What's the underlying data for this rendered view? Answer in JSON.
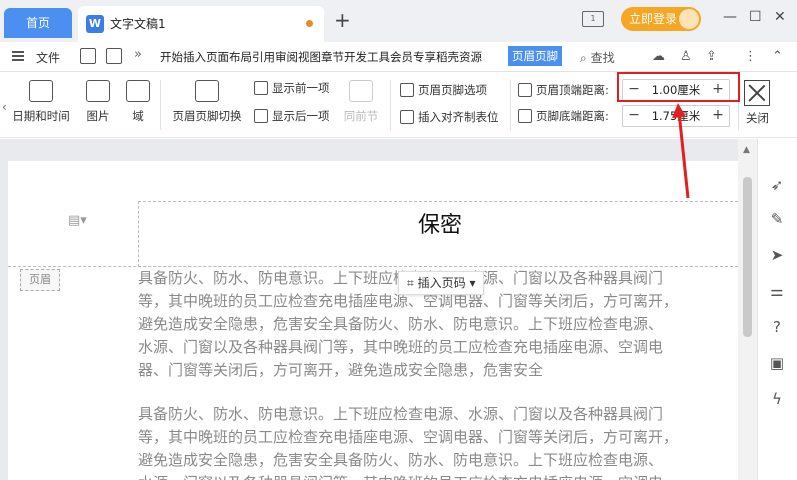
{
  "titlebar": {
    "home_tab": "首页",
    "doc_icon": "W",
    "doc_name": "文字文稿1",
    "new_tab": "+",
    "layout_icon": "1",
    "login_label": "立即登录",
    "minimize": "—",
    "maximize": "☐",
    "close": "✕"
  },
  "menubar": {
    "file_label": "文件",
    "more": "»",
    "tabs": [
      "开始",
      "插入",
      "页面布局",
      "引用",
      "审阅",
      "视图",
      "章节",
      "开发工具",
      "会员专享",
      "稻壳资源"
    ],
    "active_tab": "页眉页脚",
    "search_label": "查找",
    "more_menu": "⋮",
    "collapse": "⌃"
  },
  "ribbon": {
    "date_time": "日期和时间",
    "picture": "图片",
    "field": "域",
    "header_footer_switch": "页眉页脚切换",
    "show_previous": "显示前一项",
    "show_next": "显示后一项",
    "same_as_previous": "同前节",
    "header_footer_options": "页眉页脚选项",
    "insert_align_tab": "插入对齐制表位",
    "header_top_distance_label": "页眉顶端距离:",
    "header_top_distance_value": "1.00厘米",
    "footer_bottom_distance_label": "页脚底端距离:",
    "footer_bottom_distance_value": "1.75厘米",
    "close": "关闭"
  },
  "document": {
    "header_text": "保密",
    "header_tag": "页眉",
    "insert_page_number": "插入页码",
    "paragraph1": [
      "具备防火、防水、防电意识。上下班应检查电源、水源、门窗以及各种器具阀门",
      "等，其中晚班的员工应检查充电插座电源、空调电器、门窗等关闭后，方可离开，",
      "避免造成安全隐患，危害安全具备防火、防水、防电意识。上下班应检查电源、",
      "水源、门窗以及各种器具阀门等，其中晚班的员工应检查充电插座电源、空调电",
      "器、门窗等关闭后，方可离开，避免造成安全隐患，危害安全"
    ],
    "paragraph2": [
      "具备防火、防水、防电意识。上下班应检查电源、水源、门窗以及各种器具阀门",
      "等，其中晚班的员工应检查充电插座电源、空调电器、门窗等关闭后，方可离开，",
      "避免造成安全隐患，危害安全具备防火、防水、防电意识。上下班应检查电源、",
      "水源、门窗以及各种器具阀门等，其中晚班的员工应检查充电插座电源、空调电"
    ]
  },
  "sidebar_icons": [
    "rocket-icon",
    "pen-icon",
    "cursor-icon",
    "sliders-icon",
    "help-icon",
    "image-icon",
    "bolt-icon"
  ],
  "colors": {
    "accent": "#4b8ff0",
    "login": "#f5a623",
    "highlight": "#e02020",
    "body_text": "#8a8a8a"
  }
}
